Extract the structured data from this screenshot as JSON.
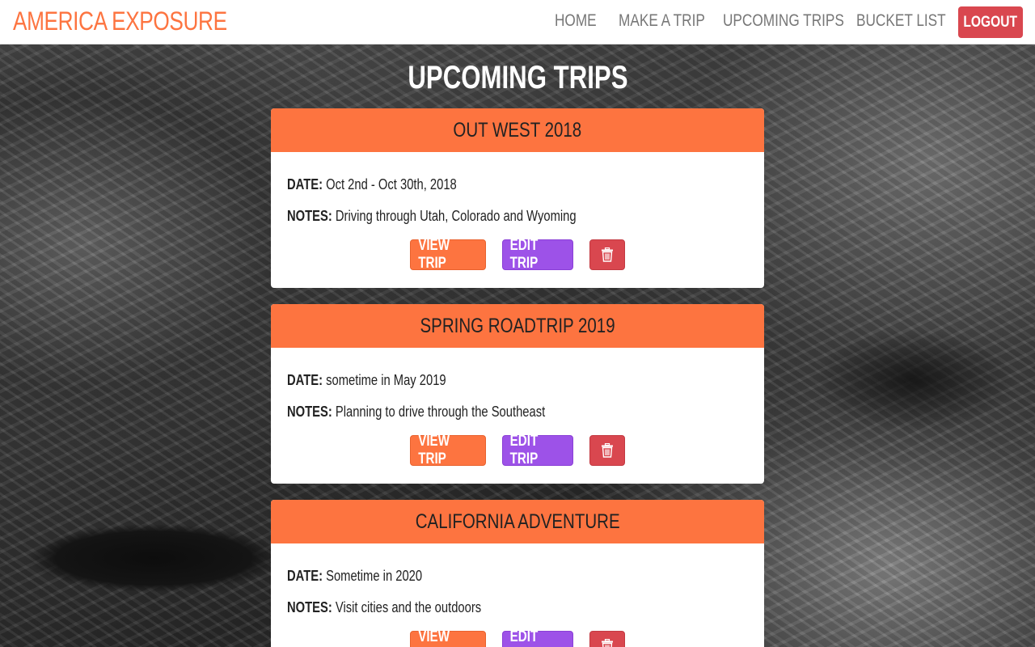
{
  "navbar": {
    "brand": "AMERICA EXPOSURE",
    "links": [
      "HOME",
      "MAKE A TRIP",
      "UPCOMING TRIPS",
      "BUCKET LIST"
    ],
    "logout_label": "LOGOUT"
  },
  "page": {
    "title": "UPCOMING TRIPS"
  },
  "labels": {
    "date": "DATE:",
    "notes": "NOTES:",
    "view": "VIEW TRIP",
    "edit": "EDIT TRIP"
  },
  "trips": [
    {
      "title": "OUT WEST 2018",
      "date": "Oct 2nd - Oct 30th, 2018",
      "notes": "Driving through Utah, Colorado and Wyoming"
    },
    {
      "title": "SPRING ROADTRIP 2019",
      "date": "sometime in May 2019",
      "notes": "Planning to drive through the Southeast"
    },
    {
      "title": "CALIFORNIA ADVENTURE",
      "date": "Sometime in 2020",
      "notes": "Visit cities and the outdoors"
    }
  ],
  "colors": {
    "accent": "#fd7440",
    "edit": "#9d52e8",
    "danger": "#d9474f"
  },
  "icons": {
    "delete": "trash-icon"
  }
}
